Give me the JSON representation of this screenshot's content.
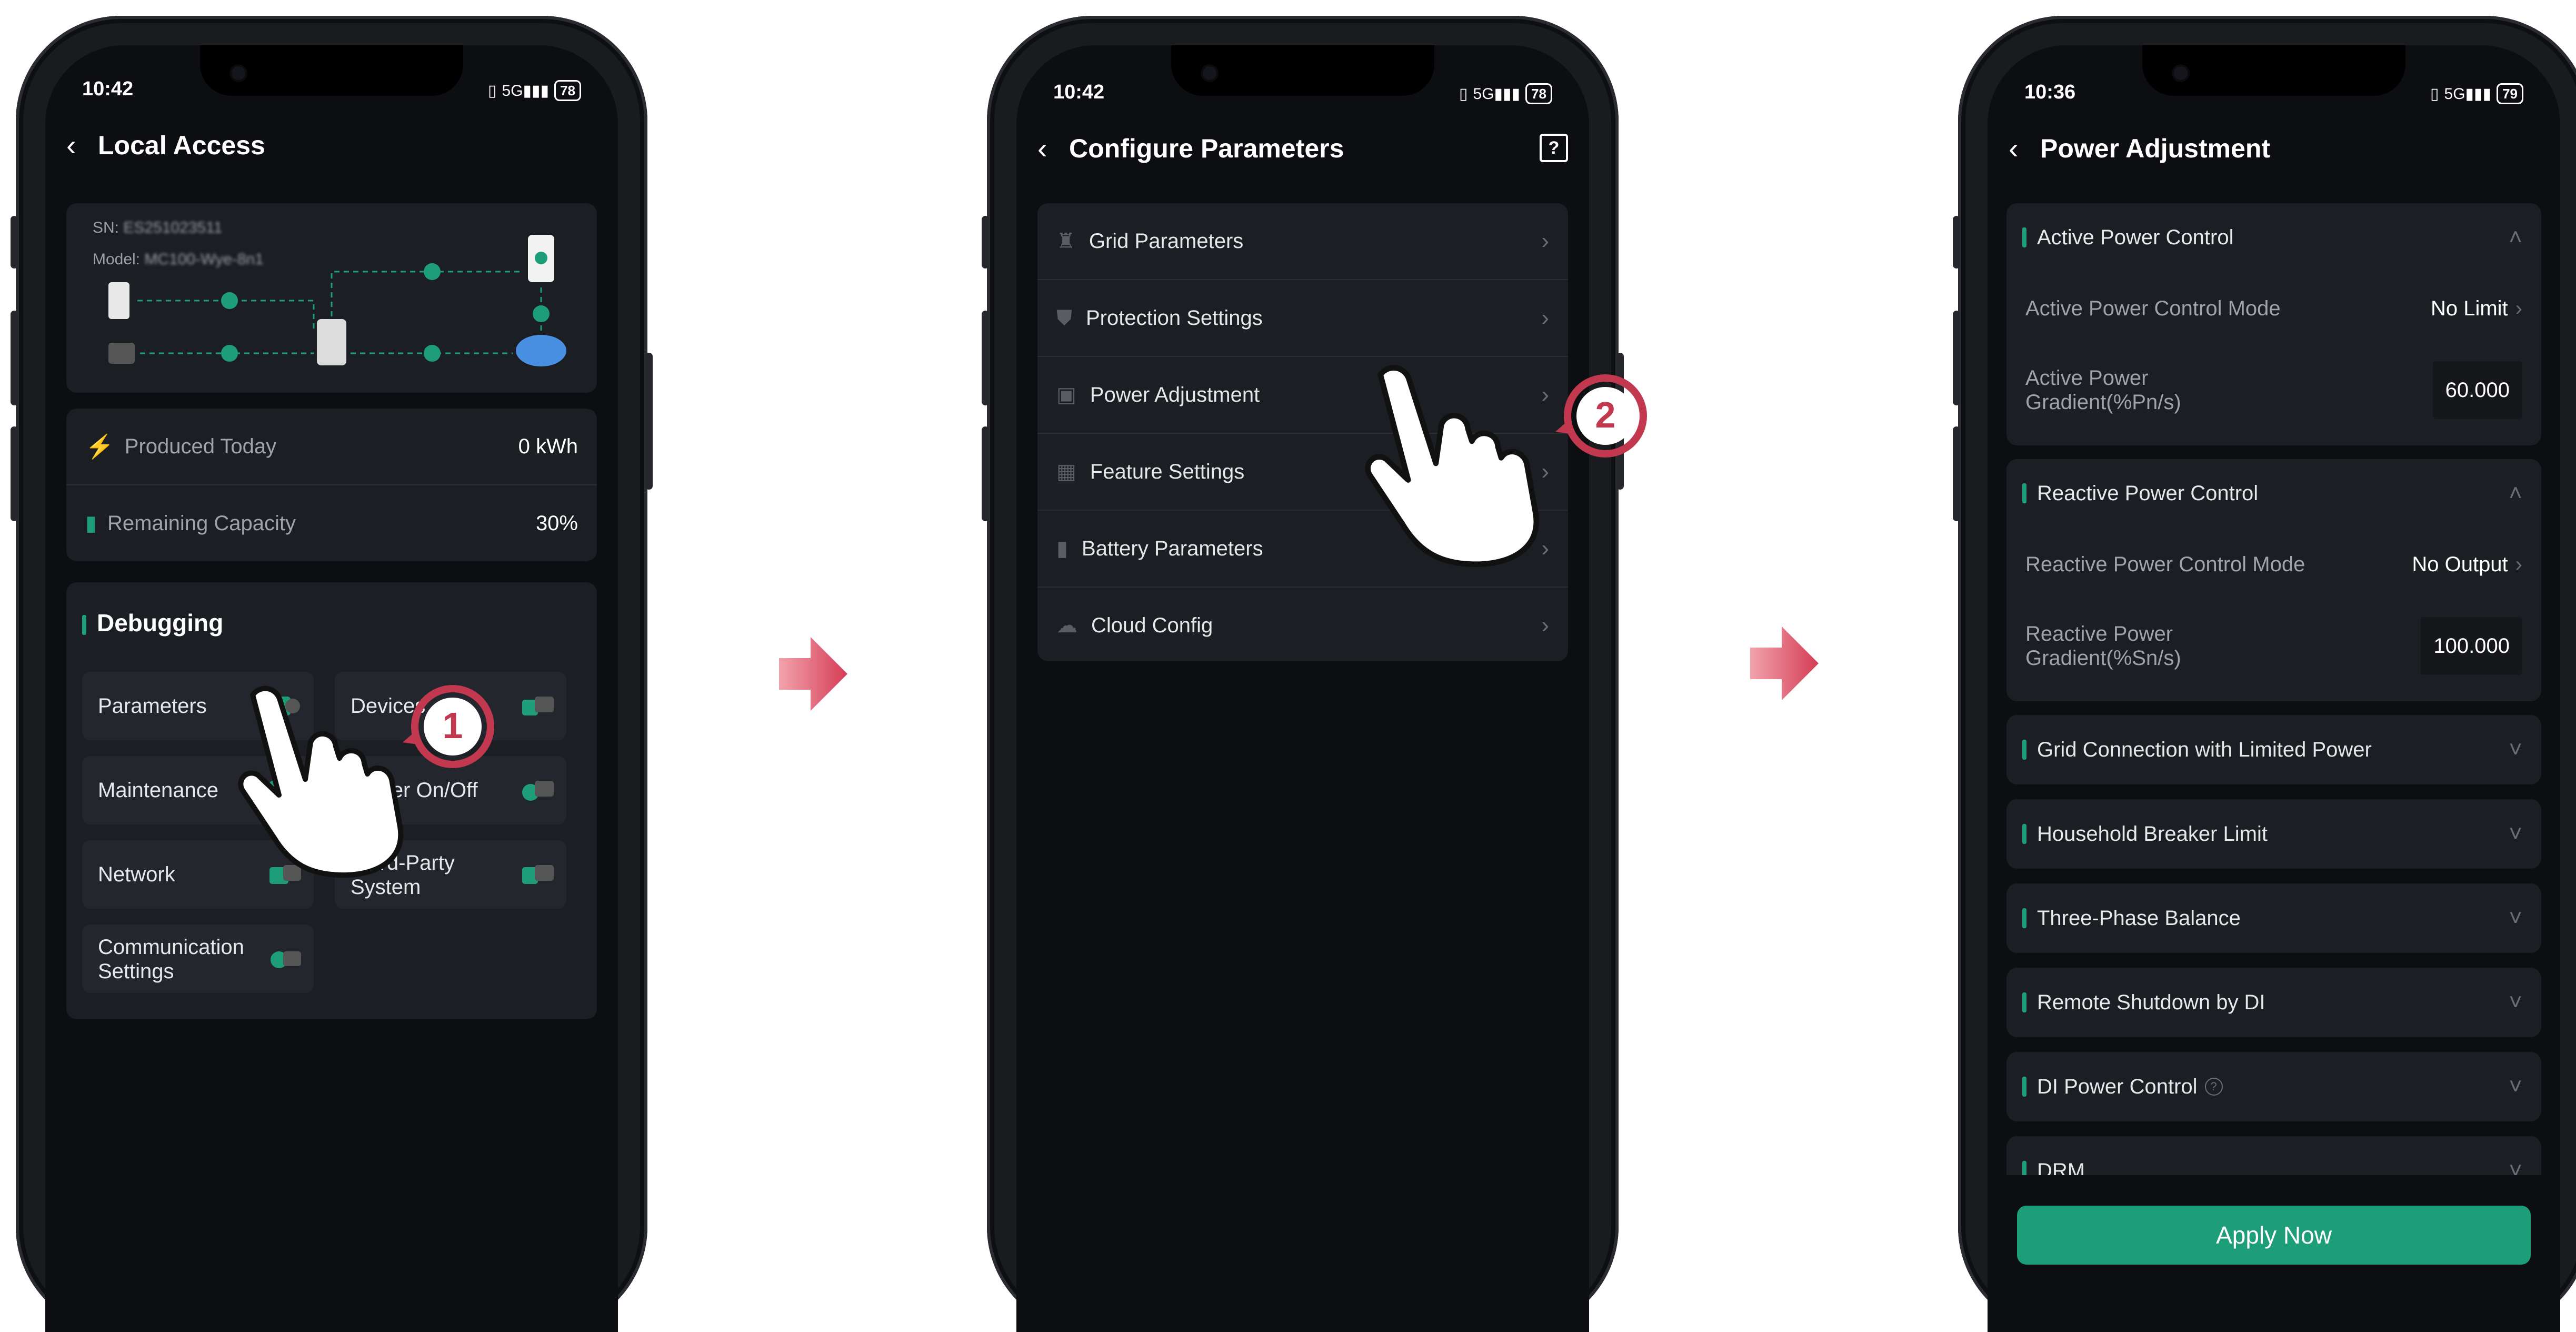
{
  "screen1": {
    "status_time": "10:42",
    "battery": "78",
    "title": "Local Access",
    "sn_label": "SN:",
    "sn_value": "ES251023511",
    "model_label": "Model:",
    "model_value": "MC100-Wye-8n1",
    "stats": [
      {
        "label": "Produced Today",
        "value": "0 kWh",
        "icon": "lightning-icon"
      },
      {
        "label": "Remaining Capacity",
        "value": "30%",
        "icon": "battery-icon"
      }
    ],
    "debug_title": "Debugging",
    "tiles": [
      {
        "label": "Parameters"
      },
      {
        "label": "Devices"
      },
      {
        "label": "Maintenance"
      },
      {
        "label": "Power On/Off"
      },
      {
        "label": "Network"
      },
      {
        "label": "Third-Party System"
      },
      {
        "label": "Communication Settings"
      }
    ],
    "step": "1"
  },
  "screen2": {
    "status_time": "10:42",
    "battery": "78",
    "title": "Configure Parameters",
    "items": [
      {
        "label": "Grid Parameters",
        "icon": "tower-icon"
      },
      {
        "label": "Protection Settings",
        "icon": "shield-icon"
      },
      {
        "label": "Power Adjustment",
        "icon": "wave-icon"
      },
      {
        "label": "Feature Settings",
        "icon": "grid-icon"
      },
      {
        "label": "Battery Parameters",
        "icon": "battery-icon"
      },
      {
        "label": "Cloud Config",
        "icon": "cloud-icon"
      }
    ],
    "step": "2"
  },
  "screen3": {
    "status_time": "10:36",
    "battery": "79",
    "title": "Power Adjustment",
    "active": {
      "title": "Active Power Control",
      "mode_label": "Active Power Control Mode",
      "mode_value": "No Limit",
      "gradient_label_1": "Active Power",
      "gradient_label_2": "Gradient(%Pn/s)",
      "gradient_value": "60.000"
    },
    "reactive": {
      "title": "Reactive Power Control",
      "mode_label": "Reactive Power Control Mode",
      "mode_value": "No Output",
      "gradient_label_1": "Reactive Power",
      "gradient_label_2": "Gradient(%Sn/s)",
      "gradient_value": "100.000"
    },
    "sections": [
      {
        "label": "Grid Connection with Limited Power"
      },
      {
        "label": "Household Breaker Limit"
      },
      {
        "label": "Three-Phase Balance"
      },
      {
        "label": "Remote Shutdown by DI"
      },
      {
        "label": "DI Power Control"
      },
      {
        "label": "DRM"
      }
    ],
    "apply_label": "Apply Now"
  },
  "colors": {
    "accent": "#1d9d78",
    "arrow": "#d9536a",
    "badge": "#c2384e"
  }
}
